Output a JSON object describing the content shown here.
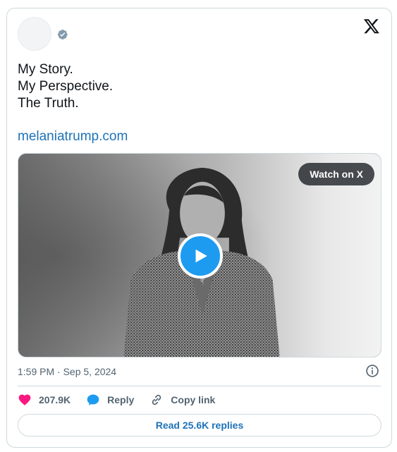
{
  "tweet": {
    "lines": [
      "My Story.",
      "My Perspective.",
      "The Truth."
    ],
    "link": "melaniatrump.com"
  },
  "media": {
    "watch_label": "Watch on X"
  },
  "meta": {
    "timestamp": "1:59 PM · Sep 5, 2024"
  },
  "actions": {
    "likes": "207.9K",
    "reply_label": "Reply",
    "copy_label": "Copy link"
  },
  "footer": {
    "read_replies": "Read 25.6K replies"
  },
  "colors": {
    "like": "#f91880",
    "reply": "#1d9bf0",
    "link": "#1d72b8",
    "verified": "#829aab"
  },
  "icons": [
    "verified-badge-icon",
    "x-logo-icon",
    "play-icon",
    "info-icon",
    "heart-icon",
    "reply-bubble-icon",
    "link-icon"
  ]
}
